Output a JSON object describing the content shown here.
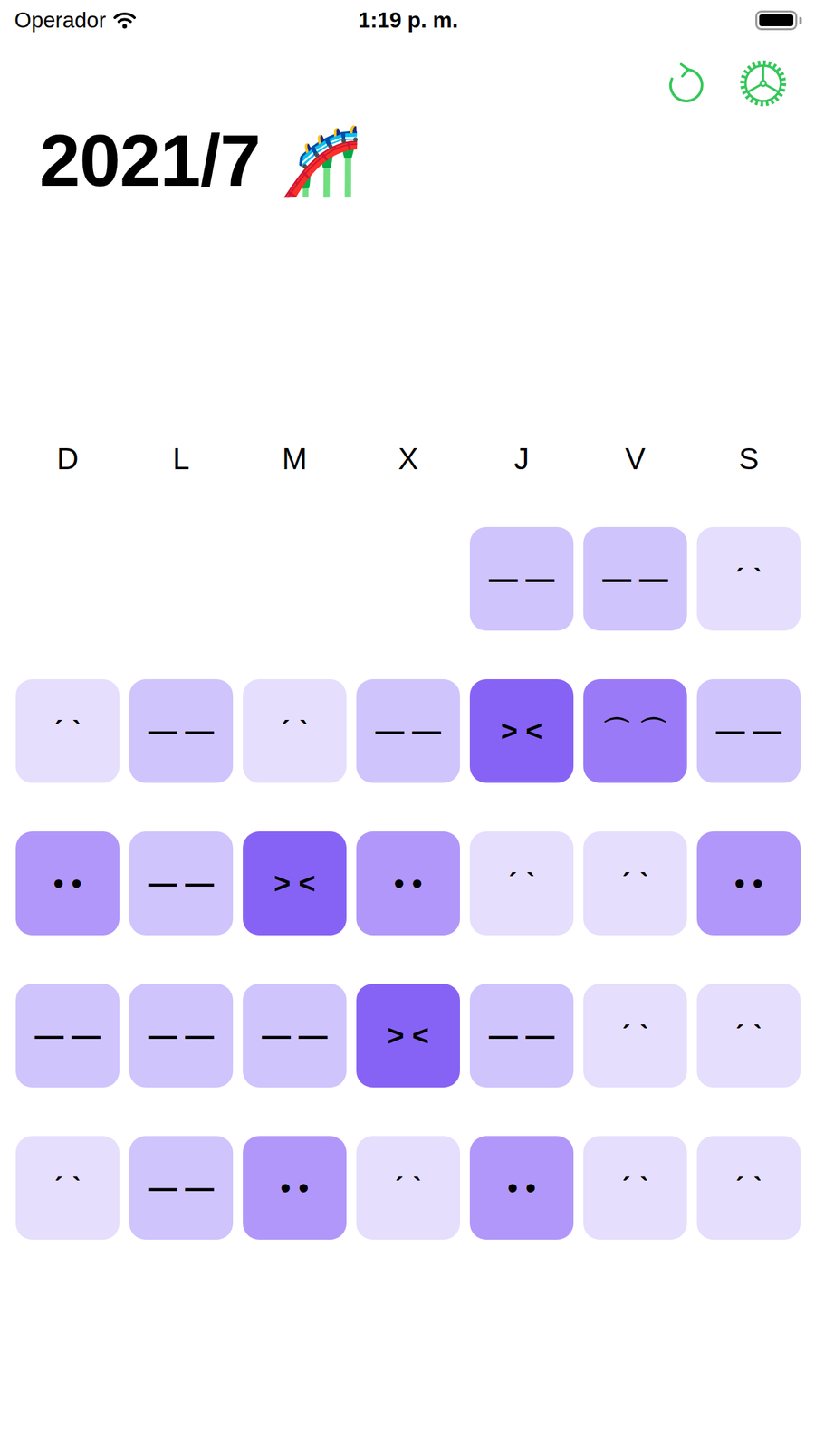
{
  "status_bar": {
    "carrier": "Operador",
    "time": "1:19 p. m.",
    "battery_level": 1
  },
  "toolbar": {
    "buttons": [
      {
        "name": "refresh"
      },
      {
        "name": "settings"
      }
    ]
  },
  "title": {
    "text": "2021/7",
    "emoji": "🎢"
  },
  "calendar": {
    "weekdays": [
      "D",
      "L",
      "M",
      "X",
      "J",
      "V",
      "S"
    ],
    "weeks": [
      [
        null,
        null,
        null,
        null,
        {
          "face": "— —",
          "color": "#D0C4FC"
        },
        {
          "face": "— —",
          "color": "#D0C4FC"
        },
        {
          "face": "ˊ ˋ",
          "color": "#E5DEFD"
        }
      ],
      [
        {
          "face": "ˊ ˋ",
          "color": "#E5DEFD"
        },
        {
          "face": "— —",
          "color": "#D0C4FC"
        },
        {
          "face": "ˊ ˋ",
          "color": "#E5DEFD"
        },
        {
          "face": "— —",
          "color": "#D0C4FC"
        },
        {
          "face": "> <",
          "color": "#8763F5"
        },
        {
          "face": "⌒ ⌒",
          "color": "#9B7AF8"
        },
        {
          "face": "— —",
          "color": "#D0C4FC"
        }
      ],
      [
        {
          "face": "• •",
          "color": "#B197F9"
        },
        {
          "face": "— —",
          "color": "#D0C4FC"
        },
        {
          "face": "> <",
          "color": "#8763F5"
        },
        {
          "face": "• •",
          "color": "#B197F9"
        },
        {
          "face": "ˊ ˋ",
          "color": "#E5DEFD"
        },
        {
          "face": "ˊ ˋ",
          "color": "#E5DEFD"
        },
        {
          "face": "• •",
          "color": "#B197F9"
        }
      ],
      [
        {
          "face": "— —",
          "color": "#D0C4FC"
        },
        {
          "face": "— —",
          "color": "#D0C4FC"
        },
        {
          "face": "— —",
          "color": "#D0C4FC"
        },
        {
          "face": "> <",
          "color": "#8763F5"
        },
        {
          "face": "— —",
          "color": "#D0C4FC"
        },
        {
          "face": "ˊ ˋ",
          "color": "#E5DEFD"
        },
        {
          "face": "ˊ ˋ",
          "color": "#E5DEFD"
        }
      ],
      [
        {
          "face": "ˊ ˋ",
          "color": "#E5DEFD"
        },
        {
          "face": "— —",
          "color": "#D0C4FC"
        },
        {
          "face": "• •",
          "color": "#B197F9"
        },
        {
          "face": "ˊ ˋ",
          "color": "#E5DEFD"
        },
        {
          "face": "• •",
          "color": "#B197F9"
        },
        {
          "face": "ˊ ˋ",
          "color": "#E5DEFD"
        },
        {
          "face": "ˊ ˋ",
          "color": "#E5DEFD"
        }
      ]
    ]
  }
}
